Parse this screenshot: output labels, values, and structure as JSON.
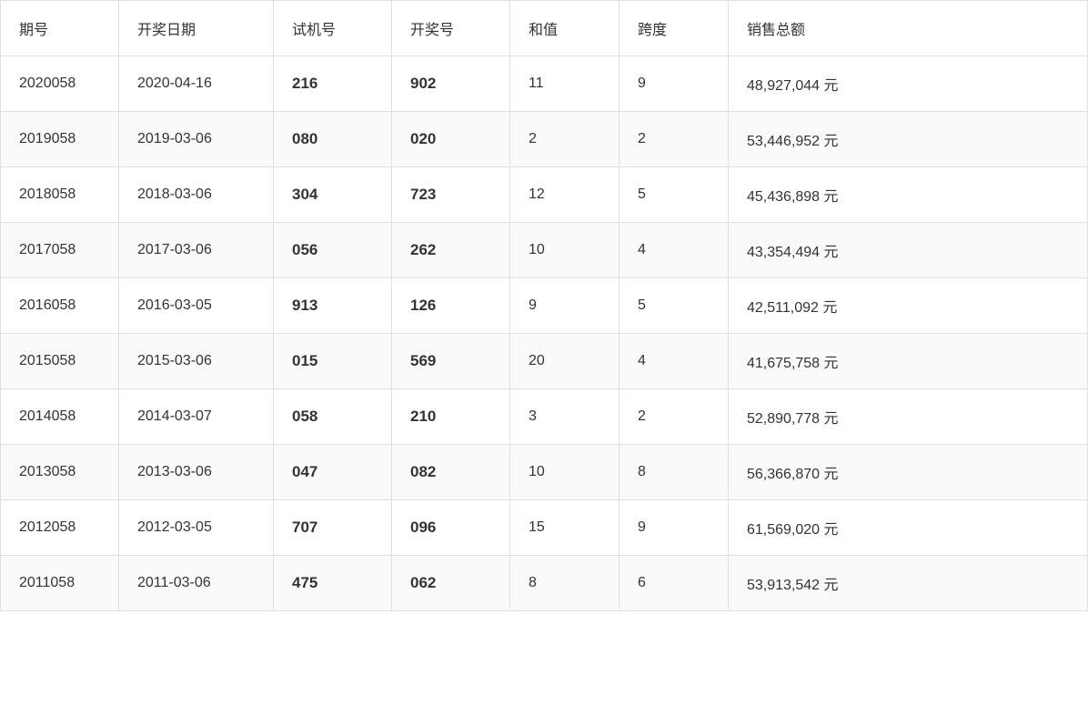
{
  "table": {
    "headers": [
      "期号",
      "开奖日期",
      "试机号",
      "开奖号",
      "和值",
      "跨度",
      "销售总额"
    ],
    "rows": [
      {
        "qihao": "2020058",
        "date": "2020-04-16",
        "shiji": "216",
        "kaijang": "902",
        "hezhi": "11",
        "kuadu": "9",
        "xiaoshou": "48,927,044 元"
      },
      {
        "qihao": "2019058",
        "date": "2019-03-06",
        "shiji": "080",
        "kaijang": "020",
        "hezhi": "2",
        "kuadu": "2",
        "xiaoshou": "53,446,952 元"
      },
      {
        "qihao": "2018058",
        "date": "2018-03-06",
        "shiji": "304",
        "kaijang": "723",
        "hezhi": "12",
        "kuadu": "5",
        "xiaoshou": "45,436,898 元"
      },
      {
        "qihao": "2017058",
        "date": "2017-03-06",
        "shiji": "056",
        "kaijang": "262",
        "hezhi": "10",
        "kuadu": "4",
        "xiaoshou": "43,354,494 元"
      },
      {
        "qihao": "2016058",
        "date": "2016-03-05",
        "shiji": "913",
        "kaijang": "126",
        "hezhi": "9",
        "kuadu": "5",
        "xiaoshou": "42,511,092 元"
      },
      {
        "qihao": "2015058",
        "date": "2015-03-06",
        "shiji": "015",
        "kaijang": "569",
        "hezhi": "20",
        "kuadu": "4",
        "xiaoshou": "41,675,758 元"
      },
      {
        "qihao": "2014058",
        "date": "2014-03-07",
        "shiji": "058",
        "kaijang": "210",
        "hezhi": "3",
        "kuadu": "2",
        "xiaoshou": "52,890,778 元"
      },
      {
        "qihao": "2013058",
        "date": "2013-03-06",
        "shiji": "047",
        "kaijang": "082",
        "hezhi": "10",
        "kuadu": "8",
        "xiaoshou": "56,366,870 元"
      },
      {
        "qihao": "2012058",
        "date": "2012-03-05",
        "shiji": "707",
        "kaijang": "096",
        "hezhi": "15",
        "kuadu": "9",
        "xiaoshou": "61,569,020 元"
      },
      {
        "qihao": "2011058",
        "date": "2011-03-06",
        "shiji": "475",
        "kaijang": "062",
        "hezhi": "8",
        "kuadu": "6",
        "xiaoshou": "53,913,542 元"
      }
    ]
  }
}
